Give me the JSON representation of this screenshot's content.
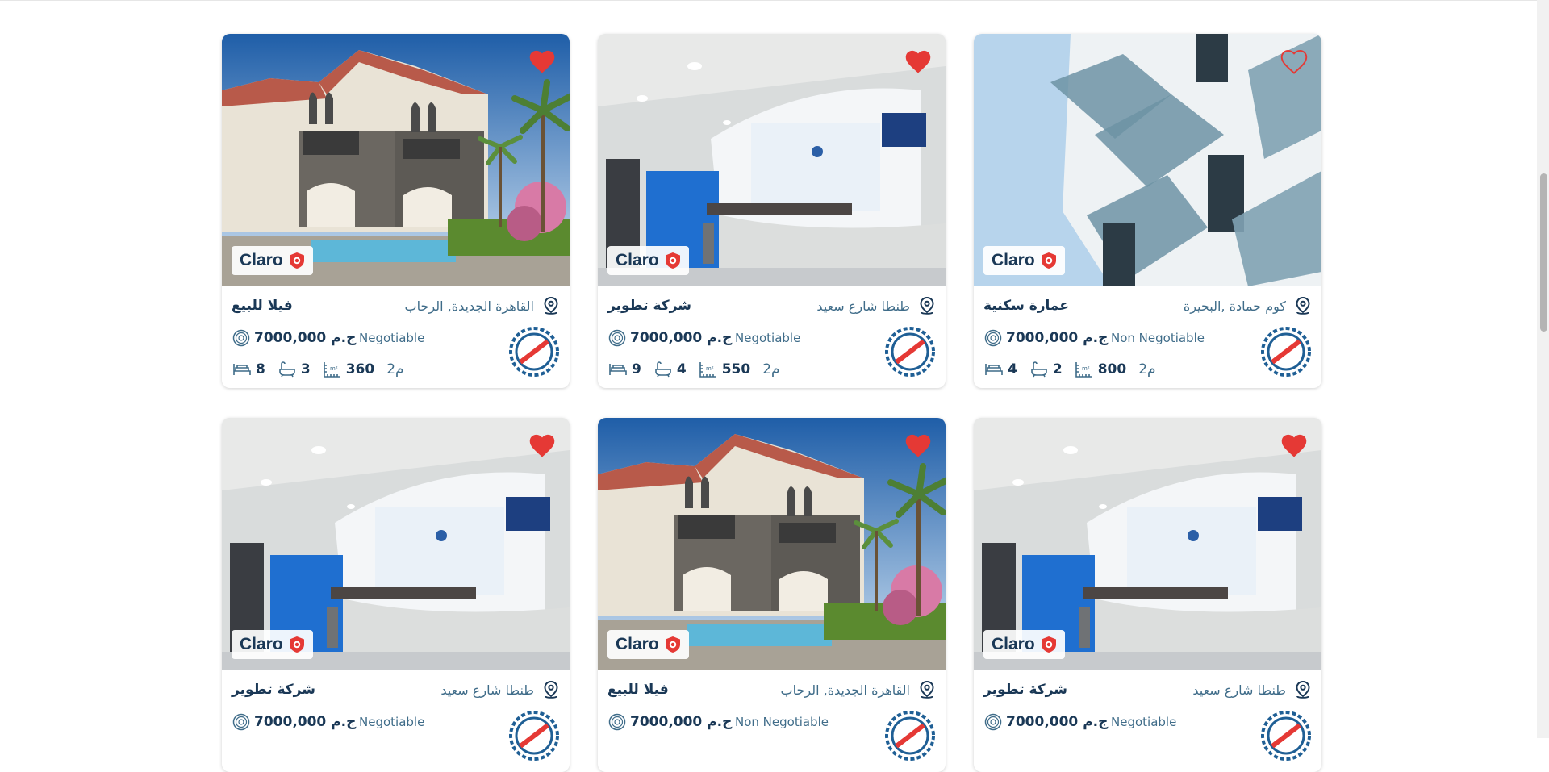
{
  "brand": "Claro",
  "listings": [
    {
      "type": "فيلا للبيع",
      "location": "القاهرة الجديدة, الرحاب",
      "price": "7000,000 ج.م",
      "negotiable": "Negotiable",
      "beds": "8",
      "baths": "3",
      "area": "360",
      "area_unit": "2م",
      "image": "villa",
      "favorite": true
    },
    {
      "type": "شركة تطوير",
      "location": "طنطا شارع سعيد",
      "price": "7000,000 ج.م",
      "negotiable": "Negotiable",
      "beds": "9",
      "baths": "4",
      "area": "550",
      "area_unit": "2م",
      "image": "office",
      "favorite": true
    },
    {
      "type": "عمارة سكنية",
      "location": "كوم حمادة ,البحيرة",
      "price": "7000,000 ج.م",
      "negotiable": "Non Negotiable",
      "beds": "4",
      "baths": "2",
      "area": "800",
      "area_unit": "2م",
      "image": "building",
      "favorite": false
    },
    {
      "type": "شركة تطوير",
      "location": "طنطا شارع سعيد",
      "price": "7000,000 ج.م",
      "negotiable": "Negotiable",
      "beds": "",
      "baths": "",
      "area": "",
      "area_unit": "",
      "image": "office",
      "favorite": true
    },
    {
      "type": "فيلا للبيع",
      "location": "القاهرة الجديدة, الرحاب",
      "price": "7000,000 ج.م",
      "negotiable": "Non Negotiable",
      "beds": "",
      "baths": "",
      "area": "",
      "area_unit": "",
      "image": "villa",
      "favorite": true
    },
    {
      "type": "شركة تطوير",
      "location": "طنطا شارع سعيد",
      "price": "7000,000 ج.م",
      "negotiable": "Negotiable",
      "beds": "",
      "baths": "",
      "area": "",
      "area_unit": "",
      "image": "office",
      "favorite": true
    }
  ],
  "icons": {
    "favorite": "heart-icon",
    "location": "location-pin-icon",
    "price": "price-tag-icon",
    "beds": "bed-icon",
    "baths": "bathtub-icon",
    "area": "area-icon",
    "verified": "shield-icon",
    "seal": "review-seal-icon"
  },
  "colors": {
    "primary": "#1a3856",
    "secondary": "#3f6c89",
    "heart": "#e53935",
    "seal": "#1f5f95",
    "seal_text": "#e53935"
  }
}
